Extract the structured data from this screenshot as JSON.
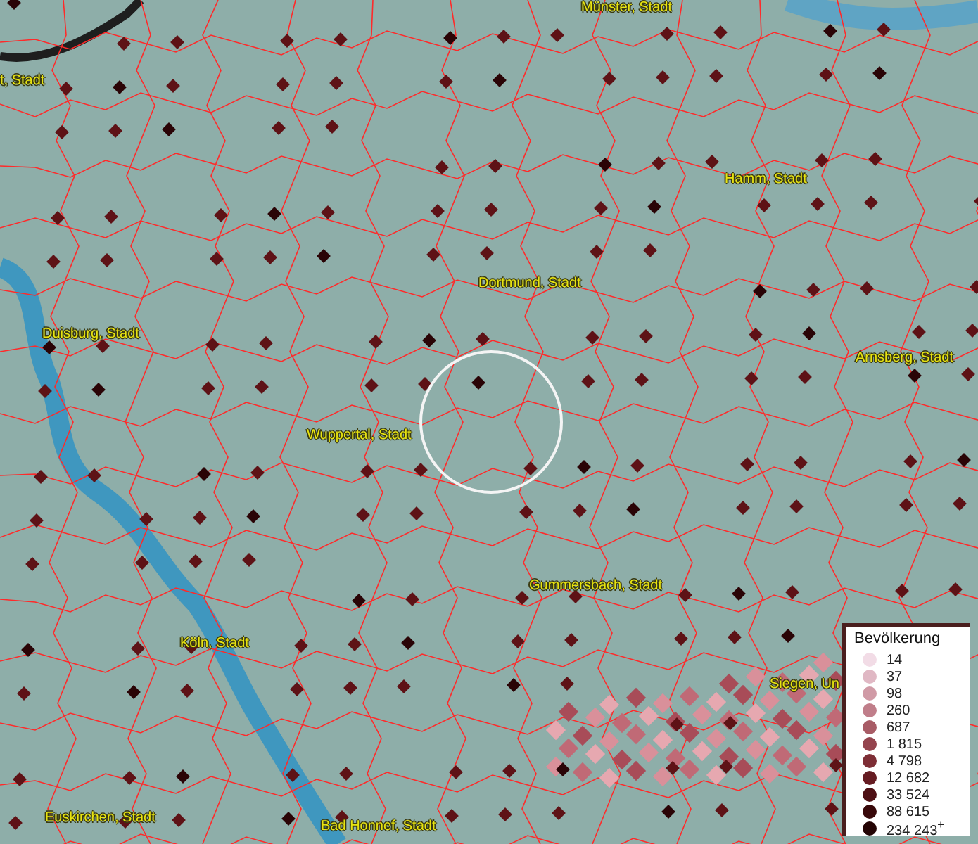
{
  "map": {
    "places": [
      {
        "name": "Münster, Stadt"
      },
      {
        "name": "t, Stadt"
      },
      {
        "name": "Hamm, Stadt"
      },
      {
        "name": "Dortmund, Stadt"
      },
      {
        "name": "Duisburg, Stadt"
      },
      {
        "name": "Arnsberg, Stadt"
      },
      {
        "name": "Wuppertal, Stadt"
      },
      {
        "name": "Gummersbach, Stadt"
      },
      {
        "name": "Köln, Stadt"
      },
      {
        "name": "Siegen, Un"
      },
      {
        "name": "Euskirchen, Stadt"
      },
      {
        "name": "Bad Honnef, Stadt"
      }
    ]
  },
  "legend": {
    "title": "Bevölkerung",
    "items": [
      {
        "label": "14",
        "color": "#f2dce6"
      },
      {
        "label": "37",
        "color": "#e0b8c4"
      },
      {
        "label": "98",
        "color": "#d09aa6"
      },
      {
        "label": "260",
        "color": "#c07e8a"
      },
      {
        "label": "687",
        "color": "#a85c66"
      },
      {
        "label": "1 815",
        "color": "#94444e"
      },
      {
        "label": "4 798",
        "color": "#7e2e36"
      },
      {
        "label": "12 682",
        "color": "#661c22"
      },
      {
        "label": "33 524",
        "color": "#4e1014"
      },
      {
        "label": "88 615",
        "color": "#38080a"
      },
      {
        "label": "234 243$^{+}$",
        "color": "#240404"
      }
    ]
  }
}
